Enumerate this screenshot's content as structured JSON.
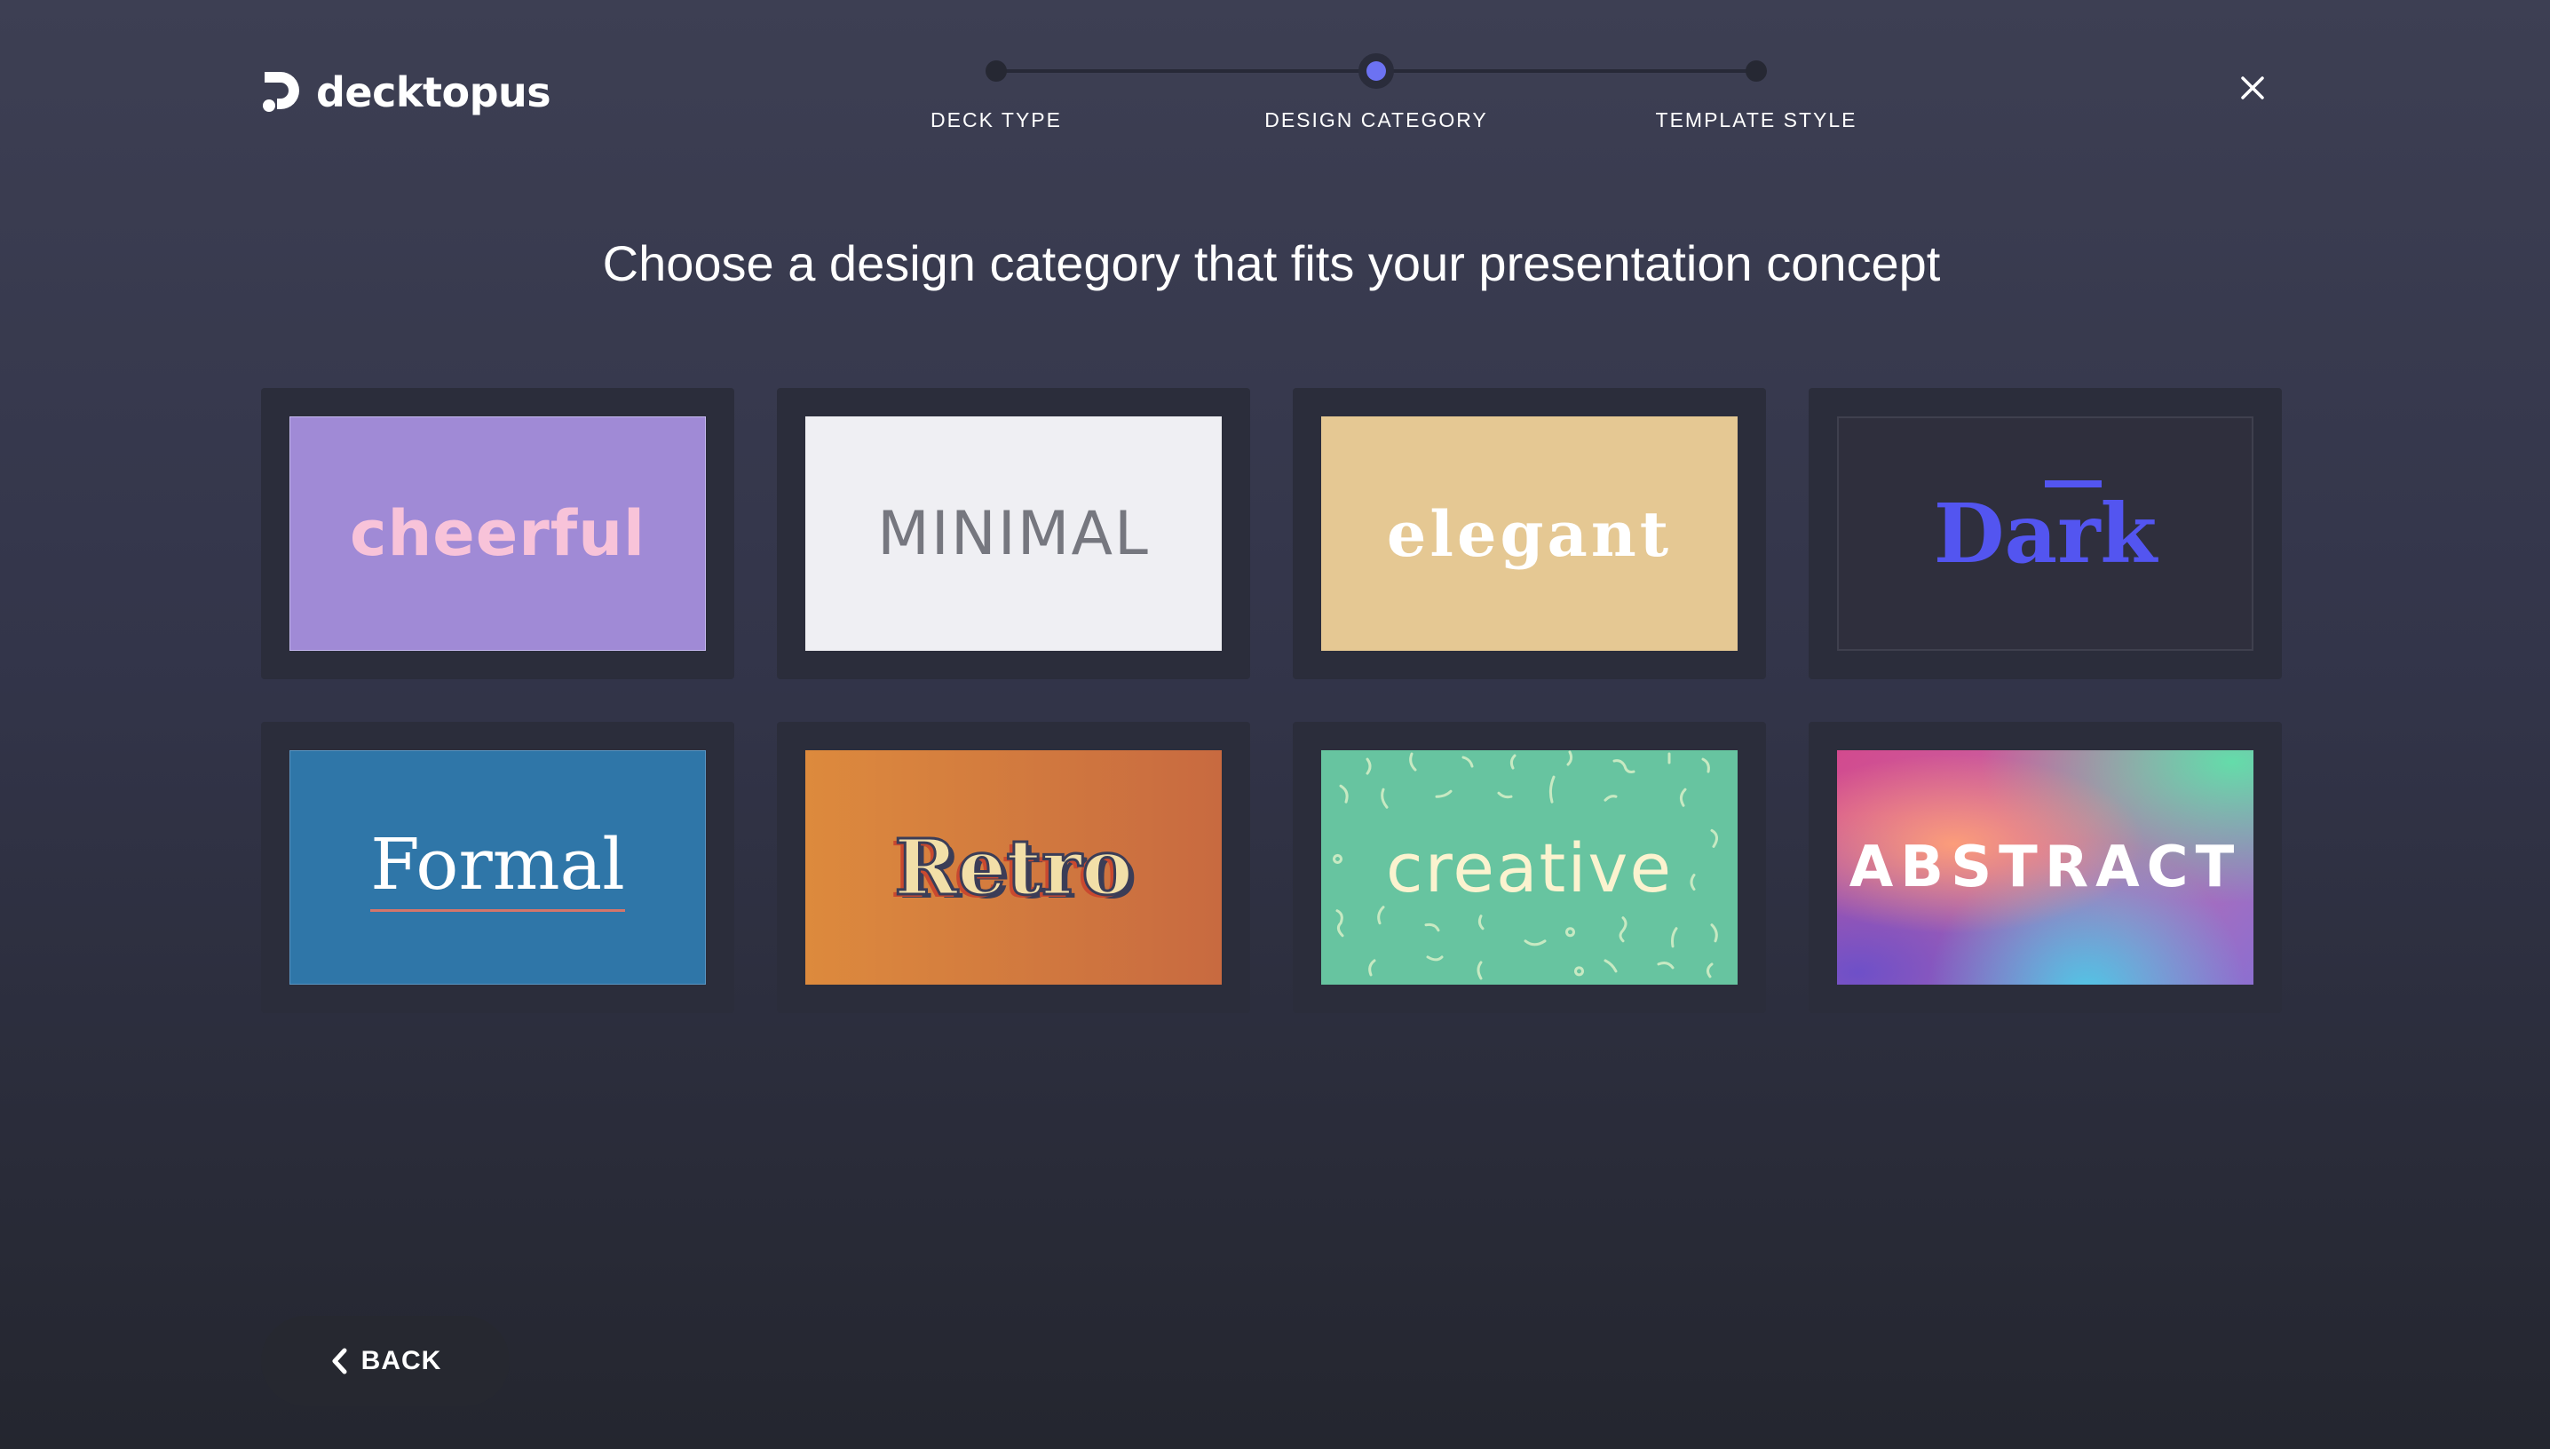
{
  "brand": {
    "name": "decktopus",
    "icon": "decktopus-logo-icon"
  },
  "stepper": {
    "steps": [
      {
        "label": "DECK TYPE",
        "state": "completed"
      },
      {
        "label": "DESIGN CATEGORY",
        "state": "active"
      },
      {
        "label": "TEMPLATE STYLE",
        "state": "upcoming"
      }
    ],
    "active_color": "#6c72f2"
  },
  "close": {
    "icon": "close-icon"
  },
  "headline": "Choose a design category that fits your presentation concept",
  "categories": [
    {
      "label": "cheerful",
      "background": "#a08ad6",
      "text_color": "#f8c3d9"
    },
    {
      "label": "MINIMAL",
      "background": "#efeff3",
      "text_color": "#76777f"
    },
    {
      "label": "elegant",
      "background": "#e5c893",
      "text_color": "#ffffff"
    },
    {
      "label": "Dark",
      "background": "#2f2f3d",
      "text_color": "#5355f0"
    },
    {
      "label": "Formal",
      "background": "#2f76a8",
      "text_color": "#ffffff"
    },
    {
      "label": "Retro",
      "background": "#d0773f",
      "text_color": "#f2dfa8"
    },
    {
      "label": "creative",
      "background": "#67c4a0",
      "text_color": "#fbf3cf"
    },
    {
      "label": "ABSTRACT",
      "background": "#c66aa8",
      "text_color": "#ffffff"
    }
  ],
  "back_button": {
    "label": "BACK",
    "icon": "chevron-left-icon"
  },
  "colors": {
    "page_background": "#383a4e",
    "card_frame": "#2b2d3b"
  }
}
